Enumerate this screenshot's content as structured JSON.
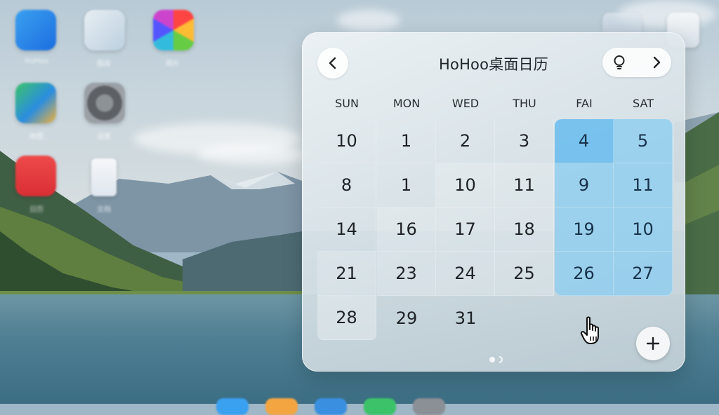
{
  "colors": {
    "accent": "#8ccdf0",
    "accent_strong": "#6ebeee",
    "text": "#1e2226",
    "panel": "#e4ecf0"
  },
  "desktop": {
    "icons": [
      {
        "name": "finder-icon",
        "label": "HoHoo"
      },
      {
        "name": "photos-viewer-icon",
        "label": "图库"
      },
      {
        "name": "photos-icon",
        "label": "照片"
      },
      {
        "name": "maps-icon",
        "label": "地图"
      },
      {
        "name": "settings-icon",
        "label": "设置"
      },
      {
        "name": "calendar-app-icon",
        "label": "日历"
      },
      {
        "name": "document-icon",
        "label": "文档"
      }
    ]
  },
  "widget": {
    "title": "HoHoo桌面日历",
    "prev_icon": "chevron-left-icon",
    "idea_icon": "lightbulb-icon",
    "next_icon": "chevron-right-icon",
    "add_icon": "plus-icon",
    "weekdays": [
      "SUN",
      "MON",
      "WED",
      "THU",
      "FAI",
      "SAT"
    ],
    "weeks": [
      [
        "10",
        "1",
        "2",
        "3",
        "4",
        "5"
      ],
      [
        "8",
        "1",
        "10",
        "11",
        "9",
        "11"
      ],
      [
        "14",
        "16",
        "17",
        "18",
        "19",
        "10"
      ],
      [
        "21",
        "23",
        "24",
        "25",
        "26",
        "27"
      ],
      [
        "28",
        "29",
        "31",
        "",
        "",
        ""
      ]
    ]
  }
}
